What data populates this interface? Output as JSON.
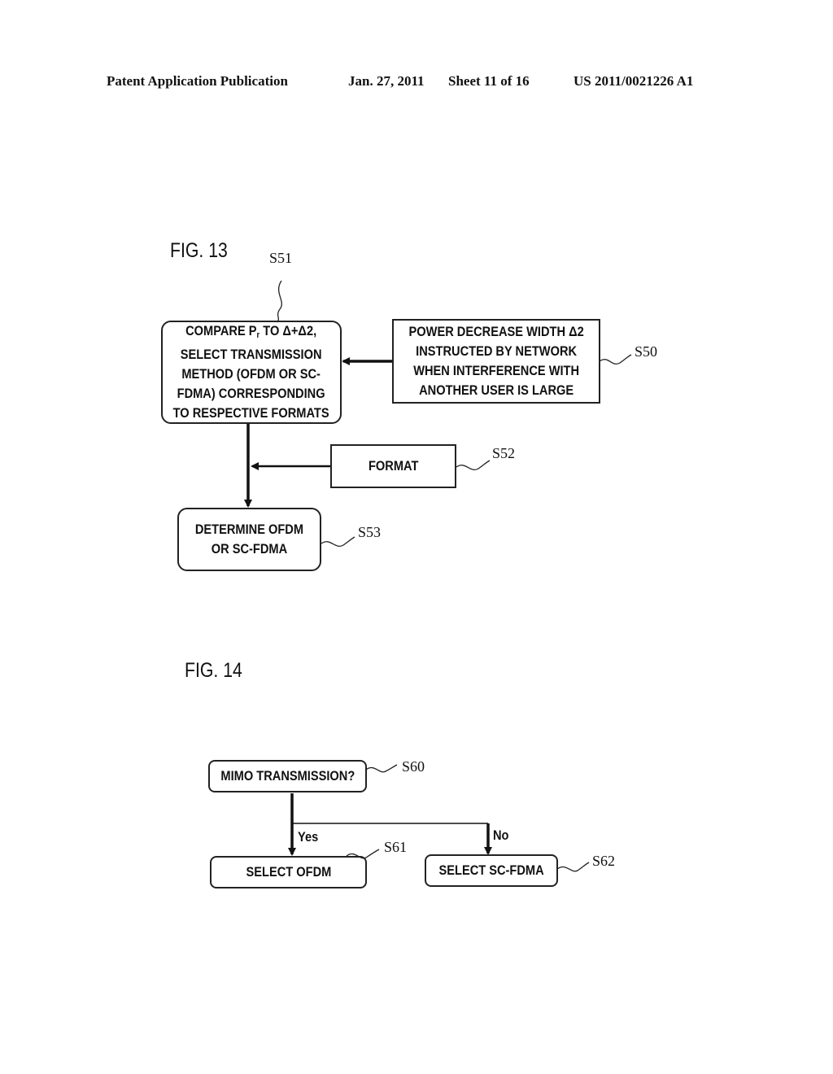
{
  "header": {
    "publication": "Patent Application Publication",
    "date": "Jan. 27, 2011",
    "sheet": "Sheet 11 of 16",
    "number": "US 2011/0021226 A1"
  },
  "fig13": {
    "title": "FIG. 13",
    "s51": {
      "ref": "S51",
      "lines": [
        "COMPARE P",
        "r",
        " TO Δ+Δ2,",
        "SELECT TRANSMISSION",
        "METHOD (OFDM OR SC-",
        "FDMA) CORRESPONDING",
        "TO RESPECTIVE FORMATS"
      ]
    },
    "s50": {
      "ref": "S50",
      "lines": [
        "POWER DECREASE WIDTH Δ2",
        "INSTRUCTED BY NETWORK",
        "WHEN INTERFERENCE WITH",
        "ANOTHER USER IS LARGE"
      ]
    },
    "s52": {
      "ref": "S52",
      "text": "FORMAT"
    },
    "s53": {
      "ref": "S53",
      "lines": [
        "DETERMINE OFDM",
        "OR SC-FDMA"
      ]
    }
  },
  "fig14": {
    "title": "FIG. 14",
    "s60": {
      "ref": "S60",
      "text": "MIMO TRANSMISSION?"
    },
    "s61": {
      "ref": "S61",
      "text": "SELECT OFDM"
    },
    "s62": {
      "ref": "S62",
      "text": "SELECT SC-FDMA"
    },
    "yes_label": "Yes",
    "no_label": "No"
  }
}
